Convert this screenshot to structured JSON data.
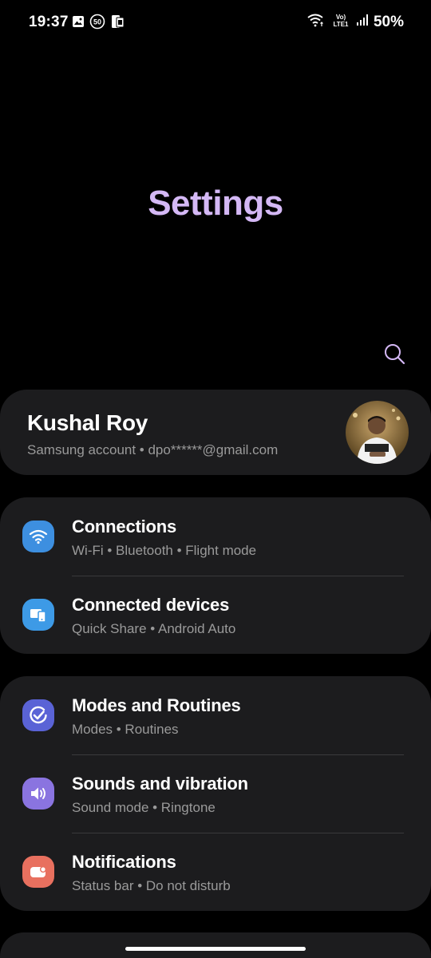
{
  "status_bar": {
    "time": "19:37",
    "battery": "50%",
    "left_icons": [
      "gallery-icon",
      "notification-50-icon",
      "sim-phone-icon"
    ],
    "right_icons": [
      "wifi-icon",
      "volte-lte1-icon",
      "signal-icon"
    ],
    "volte_top": "Vo)",
    "volte_bottom": "LTE1"
  },
  "header": {
    "title": "Settings",
    "title_color": "#d4b8f5"
  },
  "account": {
    "name": "Kushal Roy",
    "subtitle": "Samsung account  •  dpo******@gmail.com"
  },
  "groups": [
    {
      "items": [
        {
          "title": "Connections",
          "subtitle": "Wi-Fi  •  Bluetooth  •  Flight mode",
          "icon": "wifi-icon",
          "color": "#3d8fe0"
        },
        {
          "title": "Connected devices",
          "subtitle": "Quick Share  •  Android Auto",
          "icon": "connected-devices-icon",
          "color": "#3d9ae6"
        }
      ]
    },
    {
      "items": [
        {
          "title": "Modes and Routines",
          "subtitle": "Modes  •  Routines",
          "icon": "modes-routines-icon",
          "color": "#5a63d6"
        },
        {
          "title": "Sounds and vibration",
          "subtitle": "Sound mode  •  Ringtone",
          "icon": "speaker-icon",
          "color": "#8a74e0"
        },
        {
          "title": "Notifications",
          "subtitle": "Status bar  •  Do not disturb",
          "icon": "notification-icon",
          "color": "#e8705f"
        }
      ]
    }
  ]
}
